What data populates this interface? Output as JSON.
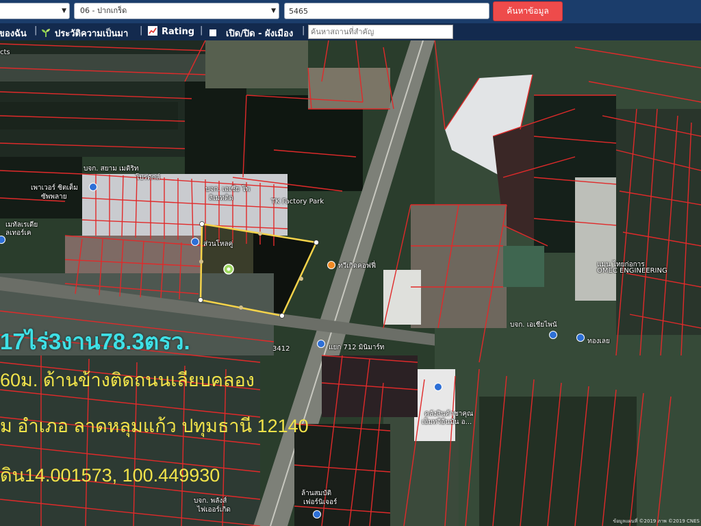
{
  "search": {
    "province_value": "",
    "district_value": "06 - ปากเกร็ด",
    "parcel_value": "5465",
    "search_button": "ค้นหาข้อมูล"
  },
  "toolbar": {
    "item1": "ของฉัน",
    "item2": "ประวัติความเป็นมา",
    "item3": "Rating",
    "item4": "เปิด/ปิด - ผังเมือง",
    "separator": "|",
    "place_placeholder": "ค้นหาสถานที่สำคัญ"
  },
  "map_labels": {
    "corner": "cts",
    "company1": "บจก. สยาม เมดิริท",
    "company1b": "โปรดักส์",
    "power": "เพาเวอร์ ซิตเต็ม",
    "power2": "ซัพพลาย",
    "company2": "บจก. เอเชีย โพ",
    "company2b": "ลิเมทติด",
    "factory": "TK Factory Park",
    "metal": "เมทัลเรเดีย",
    "metal2": "ลเทอร์เค",
    "mid1": "ส่วนโหลคู่",
    "cafe": "ทวีเกิดคอฟฟี่",
    "engineering": "OMEC ENGINEERING",
    "engineering_th": "แมนู ไทยก่อการ",
    "company3": "บจก. เอเชียไพนั",
    "store": "ทองเลย",
    "road_sign": "3412",
    "junction": "แยก 712 มินิมาร์ท",
    "warehouse": "คลังสินค้าชาคุณ",
    "warehouse2": "เอ็มทวีอีนมั่น อ...",
    "company4": "บจก. พลังส์",
    "company4b": "ไฟเออร์เกิด",
    "furniture": "ล้านสมบัติ",
    "furniture2": "เฟอร์นิเจอร์"
  },
  "overlay": {
    "area": "17ไร่3งาน78.3ตรว.",
    "line1": "60ม. ด้านข้างติดถนนเลียบคลอง",
    "line2": "ม  อำเภอ  ลาดหลุมแก้ว  ปทุมธานี  12140",
    "line3": "ดิน14.001573,  100.449930"
  },
  "attribution": "ข้อมูลแผนที่ ©2019 ภาพ ©2019 CNES"
}
